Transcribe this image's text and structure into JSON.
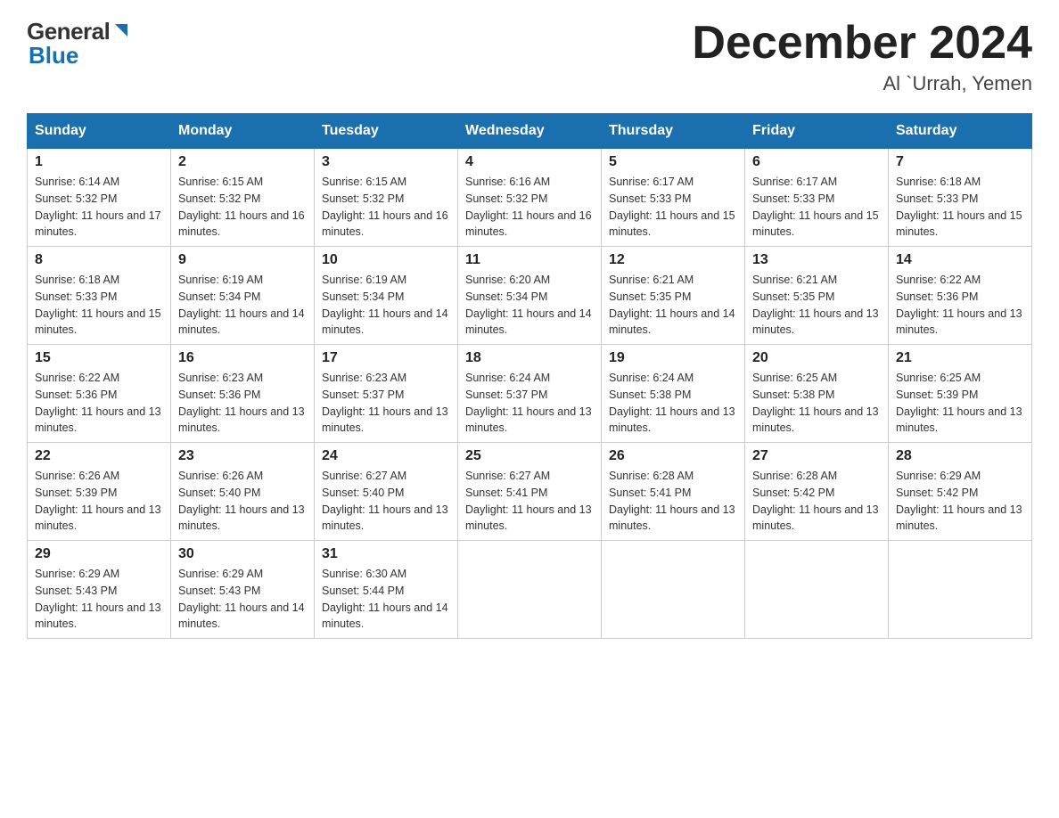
{
  "header": {
    "logo_general": "General",
    "logo_blue": "Blue",
    "title": "December 2024",
    "subtitle": "Al `Urrah, Yemen"
  },
  "weekdays": [
    "Sunday",
    "Monday",
    "Tuesday",
    "Wednesday",
    "Thursday",
    "Friday",
    "Saturday"
  ],
  "weeks": [
    [
      {
        "day": "1",
        "sunrise": "6:14 AM",
        "sunset": "5:32 PM",
        "daylight": "11 hours and 17 minutes."
      },
      {
        "day": "2",
        "sunrise": "6:15 AM",
        "sunset": "5:32 PM",
        "daylight": "11 hours and 16 minutes."
      },
      {
        "day": "3",
        "sunrise": "6:15 AM",
        "sunset": "5:32 PM",
        "daylight": "11 hours and 16 minutes."
      },
      {
        "day": "4",
        "sunrise": "6:16 AM",
        "sunset": "5:32 PM",
        "daylight": "11 hours and 16 minutes."
      },
      {
        "day": "5",
        "sunrise": "6:17 AM",
        "sunset": "5:33 PM",
        "daylight": "11 hours and 15 minutes."
      },
      {
        "day": "6",
        "sunrise": "6:17 AM",
        "sunset": "5:33 PM",
        "daylight": "11 hours and 15 minutes."
      },
      {
        "day": "7",
        "sunrise": "6:18 AM",
        "sunset": "5:33 PM",
        "daylight": "11 hours and 15 minutes."
      }
    ],
    [
      {
        "day": "8",
        "sunrise": "6:18 AM",
        "sunset": "5:33 PM",
        "daylight": "11 hours and 15 minutes."
      },
      {
        "day": "9",
        "sunrise": "6:19 AM",
        "sunset": "5:34 PM",
        "daylight": "11 hours and 14 minutes."
      },
      {
        "day": "10",
        "sunrise": "6:19 AM",
        "sunset": "5:34 PM",
        "daylight": "11 hours and 14 minutes."
      },
      {
        "day": "11",
        "sunrise": "6:20 AM",
        "sunset": "5:34 PM",
        "daylight": "11 hours and 14 minutes."
      },
      {
        "day": "12",
        "sunrise": "6:21 AM",
        "sunset": "5:35 PM",
        "daylight": "11 hours and 14 minutes."
      },
      {
        "day": "13",
        "sunrise": "6:21 AM",
        "sunset": "5:35 PM",
        "daylight": "11 hours and 13 minutes."
      },
      {
        "day": "14",
        "sunrise": "6:22 AM",
        "sunset": "5:36 PM",
        "daylight": "11 hours and 13 minutes."
      }
    ],
    [
      {
        "day": "15",
        "sunrise": "6:22 AM",
        "sunset": "5:36 PM",
        "daylight": "11 hours and 13 minutes."
      },
      {
        "day": "16",
        "sunrise": "6:23 AM",
        "sunset": "5:36 PM",
        "daylight": "11 hours and 13 minutes."
      },
      {
        "day": "17",
        "sunrise": "6:23 AM",
        "sunset": "5:37 PM",
        "daylight": "11 hours and 13 minutes."
      },
      {
        "day": "18",
        "sunrise": "6:24 AM",
        "sunset": "5:37 PM",
        "daylight": "11 hours and 13 minutes."
      },
      {
        "day": "19",
        "sunrise": "6:24 AM",
        "sunset": "5:38 PM",
        "daylight": "11 hours and 13 minutes."
      },
      {
        "day": "20",
        "sunrise": "6:25 AM",
        "sunset": "5:38 PM",
        "daylight": "11 hours and 13 minutes."
      },
      {
        "day": "21",
        "sunrise": "6:25 AM",
        "sunset": "5:39 PM",
        "daylight": "11 hours and 13 minutes."
      }
    ],
    [
      {
        "day": "22",
        "sunrise": "6:26 AM",
        "sunset": "5:39 PM",
        "daylight": "11 hours and 13 minutes."
      },
      {
        "day": "23",
        "sunrise": "6:26 AM",
        "sunset": "5:40 PM",
        "daylight": "11 hours and 13 minutes."
      },
      {
        "day": "24",
        "sunrise": "6:27 AM",
        "sunset": "5:40 PM",
        "daylight": "11 hours and 13 minutes."
      },
      {
        "day": "25",
        "sunrise": "6:27 AM",
        "sunset": "5:41 PM",
        "daylight": "11 hours and 13 minutes."
      },
      {
        "day": "26",
        "sunrise": "6:28 AM",
        "sunset": "5:41 PM",
        "daylight": "11 hours and 13 minutes."
      },
      {
        "day": "27",
        "sunrise": "6:28 AM",
        "sunset": "5:42 PM",
        "daylight": "11 hours and 13 minutes."
      },
      {
        "day": "28",
        "sunrise": "6:29 AM",
        "sunset": "5:42 PM",
        "daylight": "11 hours and 13 minutes."
      }
    ],
    [
      {
        "day": "29",
        "sunrise": "6:29 AM",
        "sunset": "5:43 PM",
        "daylight": "11 hours and 13 minutes."
      },
      {
        "day": "30",
        "sunrise": "6:29 AM",
        "sunset": "5:43 PM",
        "daylight": "11 hours and 14 minutes."
      },
      {
        "day": "31",
        "sunrise": "6:30 AM",
        "sunset": "5:44 PM",
        "daylight": "11 hours and 14 minutes."
      },
      null,
      null,
      null,
      null
    ]
  ],
  "labels": {
    "sunrise": "Sunrise:",
    "sunset": "Sunset:",
    "daylight": "Daylight:"
  }
}
